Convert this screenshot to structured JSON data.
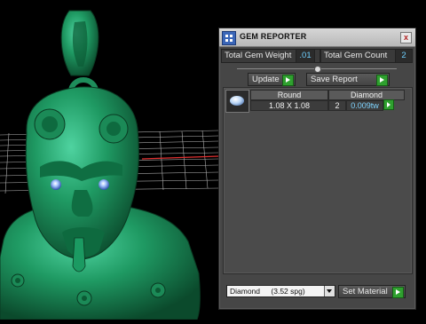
{
  "panel": {
    "title": "GEM REPORTER",
    "close_symbol": "x",
    "total_weight_label": "Total Gem Weight",
    "total_weight_value": ".01",
    "total_count_label": "Total Gem Count",
    "total_count_value": "2",
    "update_label": "Update",
    "save_report_label": "Save Report",
    "table": {
      "columns": [
        "Round",
        "Diamond"
      ],
      "rows": [
        {
          "icon": "round-gem-icon",
          "size": "1.08 X 1.08",
          "count": "2",
          "weight": "0.009tw"
        }
      ]
    },
    "material_select": {
      "value": "Diamond",
      "spg": "(3.52 spg)"
    },
    "set_material_label": "Set Material"
  },
  "colors": {
    "accent_green": "#2fa02f",
    "value_blue": "#6fd0ff",
    "model_green": "#1f8f5a"
  }
}
